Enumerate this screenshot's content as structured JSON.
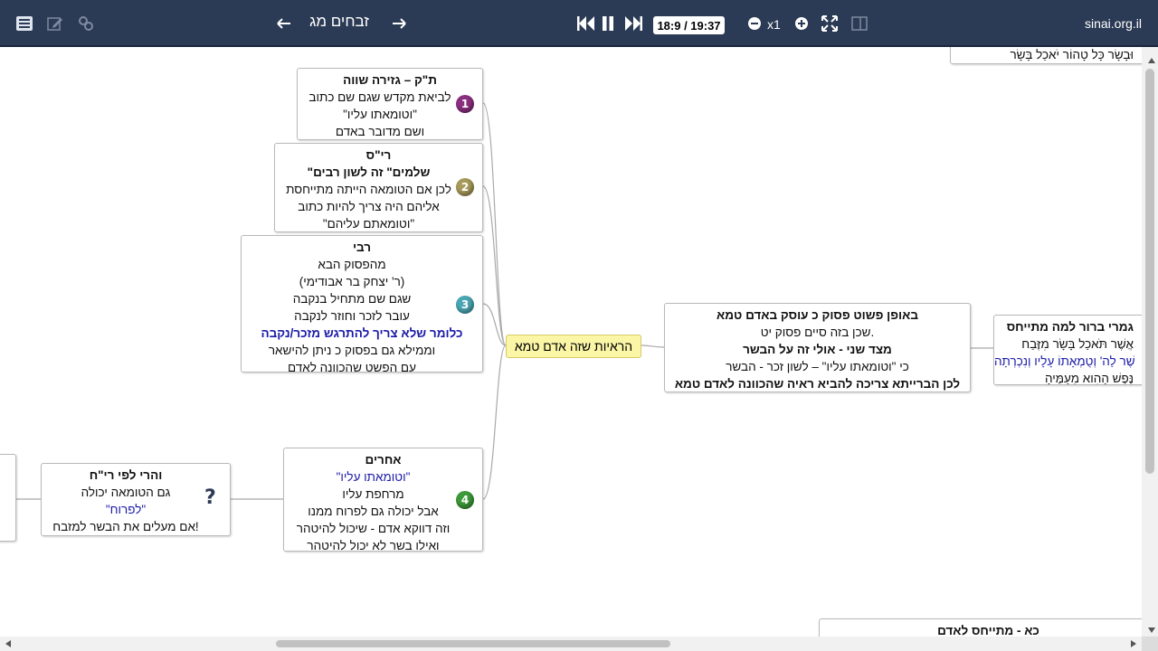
{
  "toolbar": {
    "lesson_title": "זבחים מג",
    "time": "18:9 / 19:37",
    "speed": "x1",
    "site": "sinai.org.il"
  },
  "center_node": "הראיות שזה אדם טמא",
  "nodes": {
    "n1": {
      "badge": "1",
      "lines": [
        "ת\"ק – גזירה שווה",
        "לביאת מקדש שגם שם כתוב",
        "\"וטומאתו עליו\"",
        "ושם מדובר באדם"
      ]
    },
    "n2": {
      "badge": "2",
      "lines": [
        "רי\"ס",
        "\"שלמים\" זה לשון רבים",
        "לכן אם הטומאה הייתה מתייחסת",
        "אליהם היה צריך להיות כתוב",
        "\"וטומאתם עליהם\""
      ]
    },
    "n3": {
      "badge": "3",
      "lines": [
        "רבי",
        "מהפסוק הבא",
        "(ר' יצחק בר אבודימי)",
        "שגם שם מתחיל בנקבה",
        "עובר לזכר וחוזר לנקבה",
        "כלומר שלא צריך להתרגש מזכר/נקבה",
        "וממילא גם בפסוק כ ניתן להישאר",
        "עם הפשט שהכוונה לאדם"
      ]
    },
    "n4": {
      "badge": "4",
      "lines": [
        "אחרים",
        "\"וטומאתו עליו\"",
        "מרחפת עליו",
        "אבל יכולה גם לפרוח ממנו",
        "וזה דווקא אדם - שיכול להיטהר",
        "ואילו בשר לא יכול להיטהר"
      ]
    },
    "n5": {
      "badge": "?",
      "lines": [
        "והרי לפי רי\"ח",
        "גם הטומאה יכולה",
        "\"לפרוח\"",
        "אם מעלים את הבשר למזבח!"
      ]
    },
    "n6": {
      "lines": [
        "באופן פשוט פסוק כ עוסק באדם טמא",
        "שכן בזה סיים פסוק יט.",
        "מצד שני - אולי זה על הבשר",
        "כי \"וטומאתו עליו\" – לשון זכר - הבשר",
        "לכן הברייתא צריכה להביא ראיה    שהכוונה לאדם טמא"
      ]
    },
    "n7": {
      "lines": [
        "גמרי ברור למה מתייחס",
        "אֲשֶׁר תֹּאכַל בָּשָׂר מִזֶּבַח",
        "שֶׁר לַה' וְטֻמְאָתוֹ עָלָיו וְנִכְרְתָה",
        "נֶּפֶשׁ הַהִוא מֵעַמֶּיהָ"
      ]
    },
    "n8": {
      "lines": [
        "כא - מתייחס לאדם"
      ]
    },
    "n9": {
      "lines": [
        "וּבָשָׂר כָּל טָהוֹר יֹאכַל בָּשָׂר"
      ]
    }
  },
  "colors": {
    "toolbar_bg": "#2b3a55",
    "center_node_bg": "#fbf6a6",
    "badge1": "#8b2f7f",
    "badge2": "#a79a5a",
    "badge3": "#4aa6b3",
    "badge4": "#3d9a3a",
    "question": "#2b3a55",
    "blue_text": "#1a1aa8"
  }
}
